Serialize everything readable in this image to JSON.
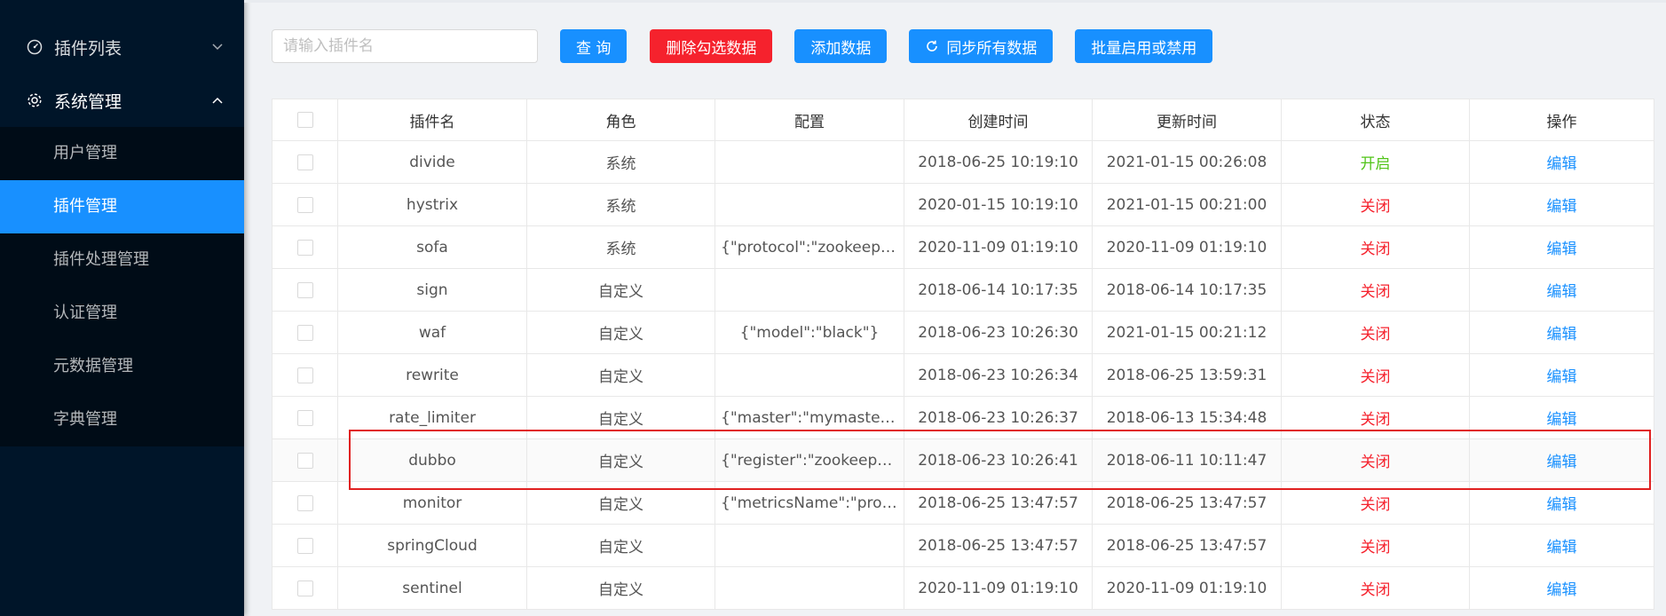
{
  "sidebar": {
    "groups": [
      {
        "label": "插件列表",
        "icon": "dashboard-icon",
        "expanded": false
      },
      {
        "label": "系统管理",
        "icon": "gear-icon",
        "expanded": true
      }
    ],
    "items": [
      {
        "label": "用户管理",
        "selected": false
      },
      {
        "label": "插件管理",
        "selected": true
      },
      {
        "label": "插件处理管理",
        "selected": false
      },
      {
        "label": "认证管理",
        "selected": false
      },
      {
        "label": "元数据管理",
        "selected": false
      },
      {
        "label": "字典管理",
        "selected": false
      }
    ]
  },
  "toolbar": {
    "search_placeholder": "请输入插件名",
    "query_label": "查 询",
    "delete_label": "删除勾选数据",
    "add_label": "添加数据",
    "sync_label": "同步所有数据",
    "batch_label": "批量启用或禁用"
  },
  "table": {
    "headers": [
      "插件名",
      "角色",
      "配置",
      "创建时间",
      "更新时间",
      "状态",
      "操作"
    ],
    "rows": [
      {
        "name": "divide",
        "role": "系统",
        "config": "",
        "created": "2018-06-25 10:19:10",
        "updated": "2021-01-15 00:26:08",
        "status": "开启",
        "action": "编辑"
      },
      {
        "name": "hystrix",
        "role": "系统",
        "config": "",
        "created": "2020-01-15 10:19:10",
        "updated": "2021-01-15 00:21:00",
        "status": "关闭",
        "action": "编辑"
      },
      {
        "name": "sofa",
        "role": "系统",
        "config": "{\"protocol\":\"zookeeper…",
        "created": "2020-11-09 01:19:10",
        "updated": "2020-11-09 01:19:10",
        "status": "关闭",
        "action": "编辑"
      },
      {
        "name": "sign",
        "role": "自定义",
        "config": "",
        "created": "2018-06-14 10:17:35",
        "updated": "2018-06-14 10:17:35",
        "status": "关闭",
        "action": "编辑"
      },
      {
        "name": "waf",
        "role": "自定义",
        "config": "{\"model\":\"black\"}",
        "created": "2018-06-23 10:26:30",
        "updated": "2021-01-15 00:21:12",
        "status": "关闭",
        "action": "编辑"
      },
      {
        "name": "rewrite",
        "role": "自定义",
        "config": "",
        "created": "2018-06-23 10:26:34",
        "updated": "2018-06-25 13:59:31",
        "status": "关闭",
        "action": "编辑"
      },
      {
        "name": "rate_limiter",
        "role": "自定义",
        "config": "{\"master\":\"mymaster\",\"…",
        "created": "2018-06-23 10:26:37",
        "updated": "2018-06-13 15:34:48",
        "status": "关闭",
        "action": "编辑"
      },
      {
        "name": "dubbo",
        "role": "自定义",
        "config": "{\"register\":\"zookeeper:…",
        "created": "2018-06-23 10:26:41",
        "updated": "2018-06-11 10:11:47",
        "status": "关闭",
        "action": "编辑"
      },
      {
        "name": "monitor",
        "role": "自定义",
        "config": "{\"metricsName\":\"prom…",
        "created": "2018-06-25 13:47:57",
        "updated": "2018-06-25 13:47:57",
        "status": "关闭",
        "action": "编辑"
      },
      {
        "name": "springCloud",
        "role": "自定义",
        "config": "",
        "created": "2018-06-25 13:47:57",
        "updated": "2018-06-25 13:47:57",
        "status": "关闭",
        "action": "编辑"
      },
      {
        "name": "sentinel",
        "role": "自定义",
        "config": "",
        "created": "2020-11-09 01:19:10",
        "updated": "2020-11-09 01:19:10",
        "status": "关闭",
        "action": "编辑"
      }
    ]
  },
  "colors": {
    "sidebar_bg": "#001529",
    "primary": "#1890ff",
    "danger": "#f5222d",
    "status_on": "#52c41a",
    "status_off": "#f5222d",
    "highlight": "#e02020"
  }
}
